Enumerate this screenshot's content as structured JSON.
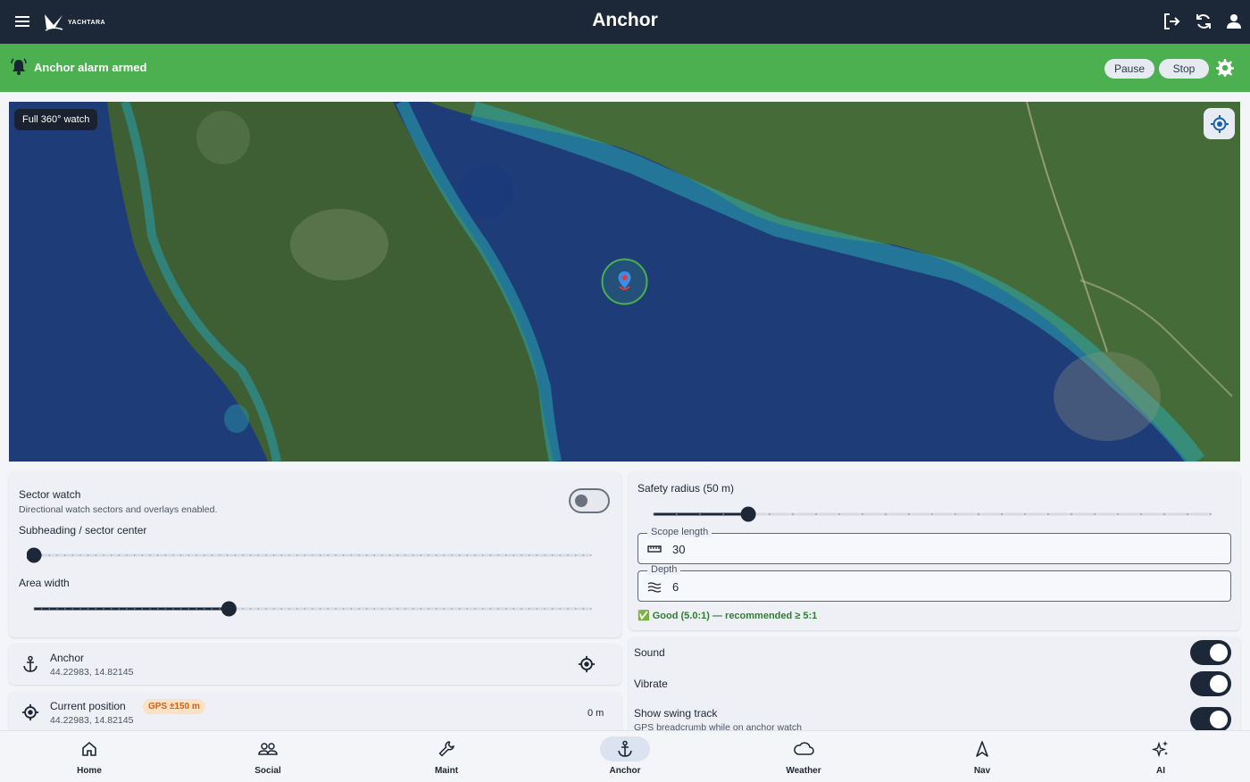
{
  "header": {
    "title": "Anchor",
    "logo_text": "YACHTARA",
    "icons": [
      "menu-icon",
      "logout-icon",
      "sync-icon",
      "account-icon"
    ]
  },
  "banner": {
    "status": "Anchor alarm armed",
    "pause_label": "Pause",
    "stop_label": "Stop",
    "color": "#4caf50"
  },
  "map": {
    "watch_mode": "Full 360° watch"
  },
  "sector": {
    "title": "Sector watch",
    "subtitle": "Directional watch sectors and overlays enabled.",
    "enabled": false,
    "subheading_label": "Subheading / sector center",
    "subheading_value": 0,
    "area_label": "Area width",
    "area_value": 0.35
  },
  "safety": {
    "radius_label": "Safety radius (50 m)",
    "radius_value": 0.17,
    "scope_label": "Scope length",
    "scope_value": "30",
    "depth_label": "Depth",
    "depth_value": "6",
    "ratio_status": "✅ Good (5.0:1) — recommended ≥ 5:1"
  },
  "anchor_pos": {
    "label": "Anchor",
    "coords": "44.22983, 14.82145"
  },
  "current_pos": {
    "label": "Current position",
    "gps_badge": "GPS ±150 m",
    "coords": "44.22983, 14.82145",
    "distance": "0 m"
  },
  "settings": {
    "sound_label": "Sound",
    "sound": true,
    "vibrate_label": "Vibrate",
    "vibrate": true,
    "swing_label": "Show swing track",
    "swing_sub": "GPS breadcrumb while on anchor watch",
    "swing": true
  },
  "nav": {
    "items": [
      {
        "label": "Home",
        "icon": "home-icon"
      },
      {
        "label": "Social",
        "icon": "people-icon"
      },
      {
        "label": "Maint",
        "icon": "wrench-icon"
      },
      {
        "label": "Anchor",
        "icon": "anchor-icon"
      },
      {
        "label": "Weather",
        "icon": "cloud-icon"
      },
      {
        "label": "Nav",
        "icon": "navigation-icon"
      },
      {
        "label": "AI",
        "icon": "sparkle-icon"
      }
    ],
    "active": "Anchor"
  }
}
